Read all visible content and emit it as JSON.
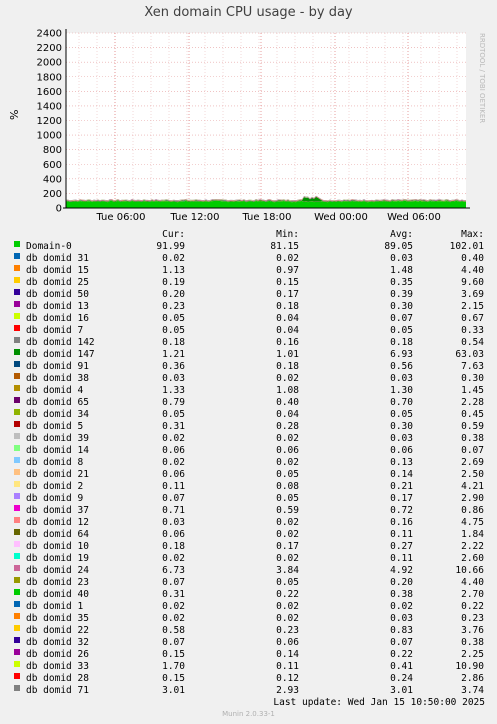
{
  "chart_data": {
    "type": "area",
    "title": "Xen domain CPU usage - by day",
    "ylabel": "%",
    "ylim": [
      0,
      2400
    ],
    "yticks": [
      "0",
      "200",
      "400",
      "600",
      "800",
      "1000",
      "1200",
      "1400",
      "1600",
      "1800",
      "2000",
      "2200",
      "2400"
    ],
    "xticks": [
      "Tue 06:00",
      "Tue 12:00",
      "Tue 18:00",
      "Wed 00:00",
      "Wed 06:00"
    ],
    "grid": true,
    "watermark": "RRDTOOL / TOBI OETIKER",
    "columns": [
      "Cur:",
      "Min:",
      "Avg:",
      "Max:"
    ],
    "series": [
      {
        "name": "Domain-0",
        "color": "#00cc00",
        "cur": "91.99",
        "min": "81.15",
        "avg": "89.05",
        "max": "102.01"
      },
      {
        "name": "db domid 31",
        "color": "#0066b3",
        "cur": "0.02",
        "min": "0.02",
        "avg": "0.03",
        "max": "0.40"
      },
      {
        "name": "db domid 15",
        "color": "#ff8000",
        "cur": "1.13",
        "min": "0.97",
        "avg": "1.48",
        "max": "4.40"
      },
      {
        "name": "db domid 25",
        "color": "#ffcc00",
        "cur": "0.19",
        "min": "0.15",
        "avg": "0.35",
        "max": "9.60"
      },
      {
        "name": "db domid 50",
        "color": "#330099",
        "cur": "0.20",
        "min": "0.17",
        "avg": "0.39",
        "max": "3.69"
      },
      {
        "name": "db domid 13",
        "color": "#990099",
        "cur": "0.23",
        "min": "0.18",
        "avg": "0.30",
        "max": "2.15"
      },
      {
        "name": "db domid 16",
        "color": "#ccff00",
        "cur": "0.05",
        "min": "0.04",
        "avg": "0.07",
        "max": "0.67"
      },
      {
        "name": "db domid 7",
        "color": "#ff0000",
        "cur": "0.05",
        "min": "0.04",
        "avg": "0.05",
        "max": "0.33"
      },
      {
        "name": "db domid 142",
        "color": "#808080",
        "cur": "0.18",
        "min": "0.16",
        "avg": "0.18",
        "max": "0.54"
      },
      {
        "name": "db domid 147",
        "color": "#008f00",
        "cur": "1.21",
        "min": "1.01",
        "avg": "6.93",
        "max": "63.03"
      },
      {
        "name": "db domid 91",
        "color": "#00487d",
        "cur": "0.36",
        "min": "0.18",
        "avg": "0.56",
        "max": "7.63"
      },
      {
        "name": "db domid 38",
        "color": "#b35a00",
        "cur": "0.03",
        "min": "0.02",
        "avg": "0.03",
        "max": "0.30"
      },
      {
        "name": "db domid 4",
        "color": "#b38f00",
        "cur": "1.33",
        "min": "1.08",
        "avg": "1.30",
        "max": "1.45"
      },
      {
        "name": "db domid 65",
        "color": "#6b006b",
        "cur": "0.79",
        "min": "0.40",
        "avg": "0.70",
        "max": "2.28"
      },
      {
        "name": "db domid 34",
        "color": "#8fb300",
        "cur": "0.05",
        "min": "0.04",
        "avg": "0.05",
        "max": "0.45"
      },
      {
        "name": "db domid 5",
        "color": "#b30000",
        "cur": "0.31",
        "min": "0.28",
        "avg": "0.30",
        "max": "0.59"
      },
      {
        "name": "db domid 39",
        "color": "#bebebe",
        "cur": "0.02",
        "min": "0.02",
        "avg": "0.03",
        "max": "0.38"
      },
      {
        "name": "db domid 14",
        "color": "#80ff80",
        "cur": "0.06",
        "min": "0.06",
        "avg": "0.06",
        "max": "0.07"
      },
      {
        "name": "db domid 8",
        "color": "#80c9ff",
        "cur": "0.02",
        "min": "0.02",
        "avg": "0.13",
        "max": "2.69"
      },
      {
        "name": "db domid 21",
        "color": "#ffc080",
        "cur": "0.06",
        "min": "0.05",
        "avg": "0.14",
        "max": "2.50"
      },
      {
        "name": "db domid 2",
        "color": "#ffe680",
        "cur": "0.11",
        "min": "0.08",
        "avg": "0.21",
        "max": "4.21"
      },
      {
        "name": "db domid 9",
        "color": "#aa80ff",
        "cur": "0.07",
        "min": "0.05",
        "avg": "0.17",
        "max": "2.90"
      },
      {
        "name": "db domid 37",
        "color": "#ee00cc",
        "cur": "0.71",
        "min": "0.59",
        "avg": "0.72",
        "max": "0.86"
      },
      {
        "name": "db domid 12",
        "color": "#ff8080",
        "cur": "0.03",
        "min": "0.02",
        "avg": "0.16",
        "max": "4.75"
      },
      {
        "name": "db domid 64",
        "color": "#666600",
        "cur": "0.06",
        "min": "0.02",
        "avg": "0.11",
        "max": "1.84"
      },
      {
        "name": "db domid 10",
        "color": "#ffbfff",
        "cur": "0.18",
        "min": "0.17",
        "avg": "0.27",
        "max": "2.22"
      },
      {
        "name": "db domid 19",
        "color": "#00ffcc",
        "cur": "0.02",
        "min": "0.02",
        "avg": "0.11",
        "max": "2.60"
      },
      {
        "name": "db domid 24",
        "color": "#cc6699",
        "cur": "6.73",
        "min": "3.84",
        "avg": "4.92",
        "max": "10.66"
      },
      {
        "name": "db domid 23",
        "color": "#999900",
        "cur": "0.07",
        "min": "0.05",
        "avg": "0.20",
        "max": "4.40"
      },
      {
        "name": "db domid 40",
        "color": "#00cc00",
        "cur": "0.31",
        "min": "0.22",
        "avg": "0.38",
        "max": "2.70"
      },
      {
        "name": "db domid 1",
        "color": "#0066b3",
        "cur": "0.02",
        "min": "0.02",
        "avg": "0.02",
        "max": "0.22"
      },
      {
        "name": "db domid 35",
        "color": "#ff8000",
        "cur": "0.02",
        "min": "0.02",
        "avg": "0.03",
        "max": "0.23"
      },
      {
        "name": "db domid 22",
        "color": "#ffcc00",
        "cur": "0.58",
        "min": "0.23",
        "avg": "0.83",
        "max": "3.76"
      },
      {
        "name": "db domid 32",
        "color": "#330099",
        "cur": "0.07",
        "min": "0.06",
        "avg": "0.07",
        "max": "0.38"
      },
      {
        "name": "db domid 26",
        "color": "#990099",
        "cur": "0.15",
        "min": "0.14",
        "avg": "0.22",
        "max": "2.25"
      },
      {
        "name": "db domid 33",
        "color": "#ccff00",
        "cur": "1.70",
        "min": "0.11",
        "avg": "0.41",
        "max": "10.90"
      },
      {
        "name": "db domid 28",
        "color": "#ff0000",
        "cur": "0.15",
        "min": "0.12",
        "avg": "0.24",
        "max": "2.86"
      },
      {
        "name": "db domid 71",
        "color": "#808080",
        "cur": "3.01",
        "min": "2.93",
        "avg": "3.01",
        "max": "3.74"
      }
    ]
  },
  "footer": {
    "last_update": "Last update:  Wed Jan 15 10:50:00 2025",
    "version": "Munin 2.0.33-1"
  }
}
